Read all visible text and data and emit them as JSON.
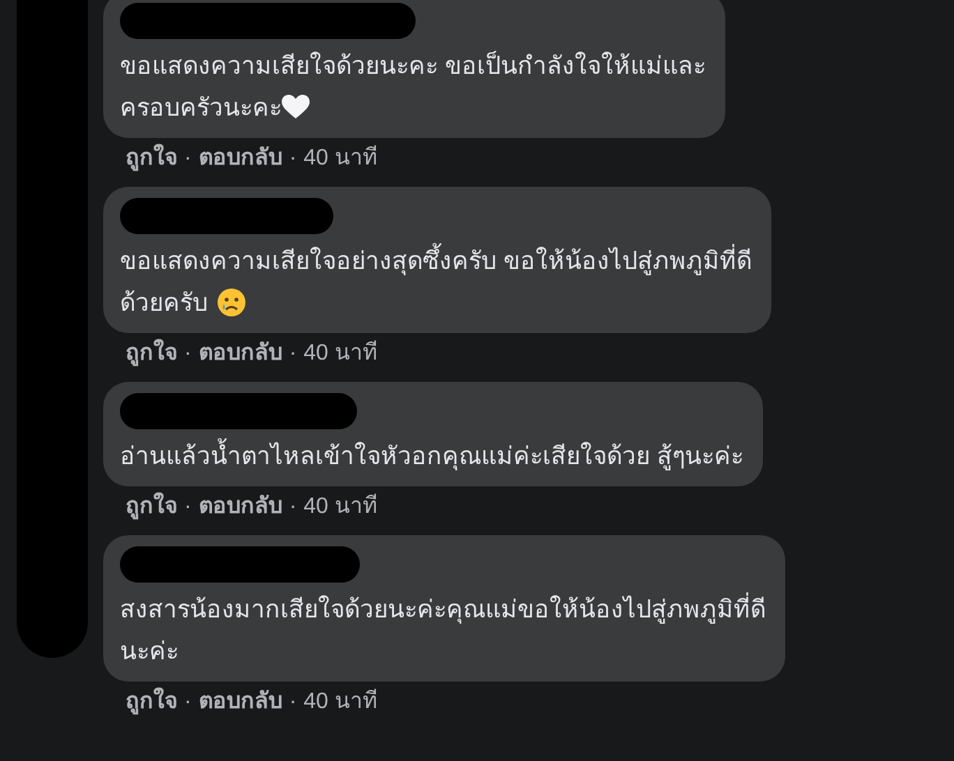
{
  "comments": [
    {
      "lines": [
        "ขอแสดงความเสียใจด้วยนะคะ ขอเป็นกำลังใจให้แม่และ",
        "ครอบครัวนะคะ"
      ],
      "emoji": {
        "kind": "heart"
      },
      "like": "ถูกใจ",
      "reply": "ตอบกลับ",
      "time": "40 นาที",
      "separators": [
        "·",
        "·"
      ]
    },
    {
      "lines": [
        "ขอแสดงความเสียใจอย่างสุดซึ้งครับ ขอให้น้องไปสู่ภพภูมิที่ดี",
        "ด้วยครับ"
      ],
      "emoji": {
        "kind": "crying-face"
      },
      "like": "ถูกใจ",
      "reply": "ตอบกลับ",
      "time": "40 นาที",
      "separators": [
        "·",
        "·"
      ]
    },
    {
      "lines": [
        "อ่านแล้วน้ำตาไหลเข้าใจหัวอกคุณแม่ค่ะเสียใจด้วย สู้ๆนะค่ะ"
      ],
      "like": "ถูกใจ",
      "reply": "ตอบกลับ",
      "time": "40 นาที",
      "separators": [
        "·",
        "·"
      ]
    },
    {
      "lines": [
        "สงสารน้องมากเสียใจด้วยนะค่ะคุณแม่ขอให้น้องไปสู่ภพภูมิที่ดี",
        "นะค่ะ"
      ],
      "like": "ถูกใจ",
      "reply": "ตอบกลับ",
      "time": "40 นาที",
      "separators": [
        "·",
        "·"
      ]
    }
  ]
}
